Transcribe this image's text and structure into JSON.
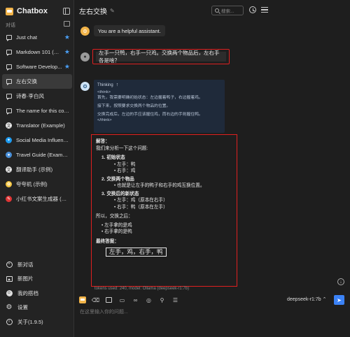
{
  "app": {
    "name": "Chatbox"
  },
  "sidebar": {
    "section_label": "对话",
    "sessions": [
      {
        "label": "Just chat",
        "icon": "chat-icon",
        "starred": true
      },
      {
        "label": "Markdown 101 (Ex...",
        "icon": "chat-icon",
        "starred": true
      },
      {
        "label": "Software Develop...",
        "icon": "chat-icon",
        "starred": true
      },
      {
        "label": "左右交换",
        "icon": "chat-icon",
        "starred": false,
        "active": true
      },
      {
        "label": "诗春·李白风",
        "icon": "chat-icon",
        "starred": false
      },
      {
        "label": "The name for this conve...",
        "icon": "chat-icon",
        "starred": false
      },
      {
        "label": "Translator (Example)",
        "icon": "translator-avatar",
        "starred": false
      },
      {
        "label": "Social Media Influencer ...",
        "icon": "twitter-avatar",
        "starred": false
      },
      {
        "label": "Travel Guide (Example)",
        "icon": "travel-avatar",
        "starred": false
      },
      {
        "label": "翻译助手 (示例)",
        "icon": "translate-avatar",
        "starred": false
      },
      {
        "label": "夸夸机 (示例)",
        "icon": "praise-avatar",
        "starred": false
      },
      {
        "label": "小红书文案生成器 (示例)",
        "icon": "xiaohongshu-avatar",
        "starred": false
      }
    ],
    "bottom": [
      {
        "label": "新对话",
        "icon": "plus-circle-icon"
      },
      {
        "label": "新图片",
        "icon": "image-icon"
      },
      {
        "label": "我的搭档",
        "icon": "partner-icon"
      },
      {
        "label": "设置",
        "icon": "gear-icon"
      },
      {
        "label": "关于(1.9.5)",
        "icon": "info-icon"
      }
    ]
  },
  "header": {
    "title": "左右交换",
    "search_placeholder": "搜索..."
  },
  "messages": {
    "system": "You are a helpful assistant.",
    "user": "左手一只鸭，右手一只鸡。交换两个物品后，左右手各是啥？",
    "thinking": {
      "label": "Thinking",
      "lines": [
        "<think>",
        "首先，我需要明确初始状态：左边握着鸭子，右边握着鸡。",
        "",
        "接下来，按照要求交换两个物品的位置。",
        "",
        "交换完成后，左边的手应该握住鸡，而右边的手则握住鸭。",
        "</think>"
      ]
    },
    "answer": {
      "heading": "解答：",
      "intro": "我们来分析一下这个问题:",
      "step1_title": "1. 初始状态",
      "step1_items": [
        "左手：鸭",
        "右手：鸡"
      ],
      "step2_title": "2. 交换两个物品",
      "step2_items": [
        "也就是让左手的鸭子和右手的鸡互换位置。"
      ],
      "step3_title": "3. 交换后的新状态",
      "step3_items": [
        "左手：鸡（原本在右手）",
        "右手：鸭（原本在左手）"
      ],
      "conclusion_intro": "所以，交换之后：",
      "conclusion_items": [
        "左手拿的是鸡",
        "右手拿的是鸭"
      ],
      "final_label": "最终答案：",
      "final_answer": "左手，鸡，右手，鸭"
    },
    "meta": "tokens used: 240, model: Ollama (deepseek-r1:7b)"
  },
  "input": {
    "placeholder": "在这里输入你的问题...",
    "model": "deepseek-r1:7b ⌃"
  }
}
